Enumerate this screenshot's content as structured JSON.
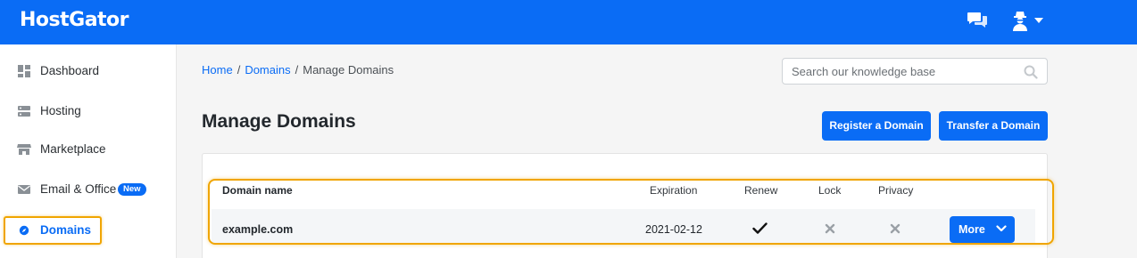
{
  "colors": {
    "brand": "#0a6cf5",
    "highlight": "#f0a500",
    "text": "#23282d"
  },
  "header": {
    "logo": "HostGator",
    "chat_icon": "chat-icon",
    "user_icon": "user-icon"
  },
  "sidebar": {
    "items": [
      {
        "label": "Dashboard",
        "icon": "dashboard-icon"
      },
      {
        "label": "Hosting",
        "icon": "server-icon"
      },
      {
        "label": "Marketplace",
        "icon": "store-icon"
      },
      {
        "label": "Email & Office",
        "icon": "email-icon",
        "badge": "New"
      },
      {
        "label": "Domains",
        "icon": "compass-icon",
        "active": true
      }
    ]
  },
  "breadcrumb": {
    "home": "Home",
    "sep1": "/",
    "domains": "Domains",
    "sep2": "/",
    "current": "Manage Domains"
  },
  "search": {
    "placeholder": "Search our knowledge base"
  },
  "page": {
    "title": "Manage Domains",
    "register_label": "Register a Domain",
    "transfer_label": "Transfer a Domain"
  },
  "table": {
    "columns": [
      "Domain name",
      "Expiration",
      "Renew",
      "Lock",
      "Privacy"
    ],
    "rows": [
      {
        "domain": "example.com",
        "expiration": "2021-02-12",
        "renew": "check-icon",
        "lock": "x-icon",
        "privacy": "x-icon",
        "action_label": "More"
      }
    ]
  }
}
